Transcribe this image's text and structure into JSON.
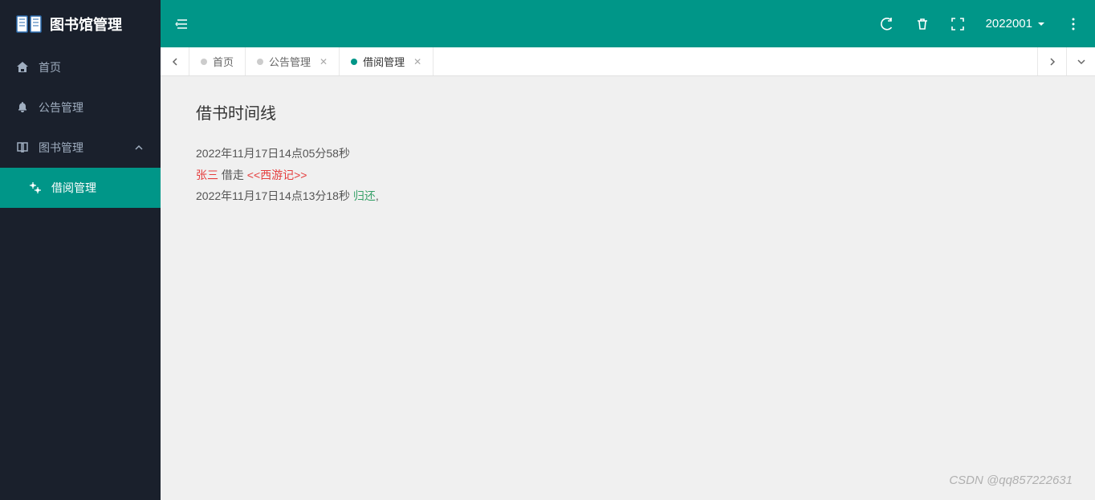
{
  "app": {
    "title": "图书馆管理"
  },
  "sidebar": {
    "items": [
      {
        "icon": "home",
        "label": "首页"
      },
      {
        "icon": "bell",
        "label": "公告管理"
      },
      {
        "icon": "book",
        "label": "图书管理",
        "expandable": true,
        "expanded": true
      },
      {
        "icon": "cogs",
        "label": "借阅管理",
        "sub": true,
        "active": true
      }
    ]
  },
  "topbar": {
    "user": "2022001"
  },
  "tabs": {
    "items": [
      {
        "label": "首页",
        "closable": false,
        "active": false
      },
      {
        "label": "公告管理",
        "closable": true,
        "active": false
      },
      {
        "label": "借阅管理",
        "closable": true,
        "active": true
      }
    ]
  },
  "content": {
    "title": "借书时间线",
    "timeline": {
      "borrow_time": "2022年11月17日14点05分58秒",
      "borrower": "张三",
      "action_borrow": "借走",
      "book": "<<西游记>>",
      "return_time": "2022年11月17日14点13分18秒",
      "action_return": "归还",
      "trailing": ","
    }
  },
  "watermark": "CSDN @qq857222631"
}
